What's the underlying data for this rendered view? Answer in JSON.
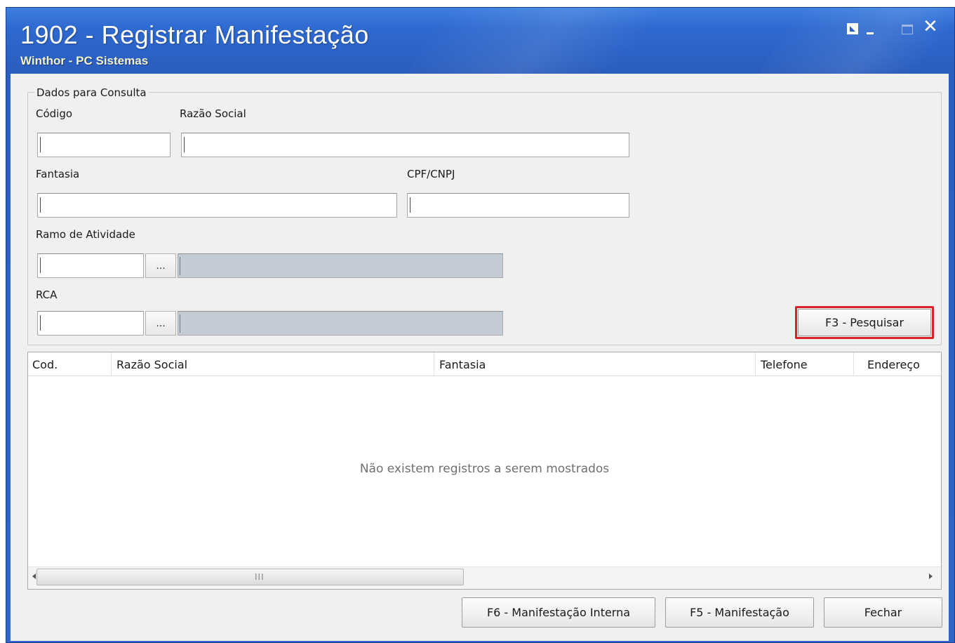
{
  "window": {
    "title": "1902 - Registrar Manifestação",
    "subtitle": "Winthor - PC Sistemas",
    "controls": [
      "restore-icon",
      "minimize-icon",
      "maximize-icon",
      "close-icon"
    ],
    "close_glyph": "✕"
  },
  "query_panel": {
    "legend": "Dados para Consulta",
    "codigo": {
      "label": "Código",
      "value": ""
    },
    "razao_social": {
      "label": "Razão Social",
      "value": ""
    },
    "fantasia": {
      "label": "Fantasia",
      "value": ""
    },
    "cpf_cnpj": {
      "label": "CPF/CNPJ",
      "value": ""
    },
    "ramo_atividade": {
      "label": "Ramo de Atividade",
      "code": "",
      "description": "",
      "lookup_label": "..."
    },
    "rca": {
      "label": "RCA",
      "code": "",
      "description": "",
      "lookup_label": "..."
    },
    "search_button": "F3 - Pesquisar"
  },
  "results_grid": {
    "columns": [
      "Cod.",
      "Razão Social",
      "Fantasia",
      "Telefone",
      "Endereço"
    ],
    "rows": [],
    "empty_message": "Não existem registros a serem mostrados",
    "scroll_grip": "III"
  },
  "footer": {
    "internal_button": "F6 - Manifestação Interna",
    "manifest_button": "F5 - Manifestação",
    "close_button": "Fechar"
  },
  "colors": {
    "titlebar": "#2c62c6",
    "highlight": "#d8232a",
    "readonly_field": "#c3ccd4"
  }
}
